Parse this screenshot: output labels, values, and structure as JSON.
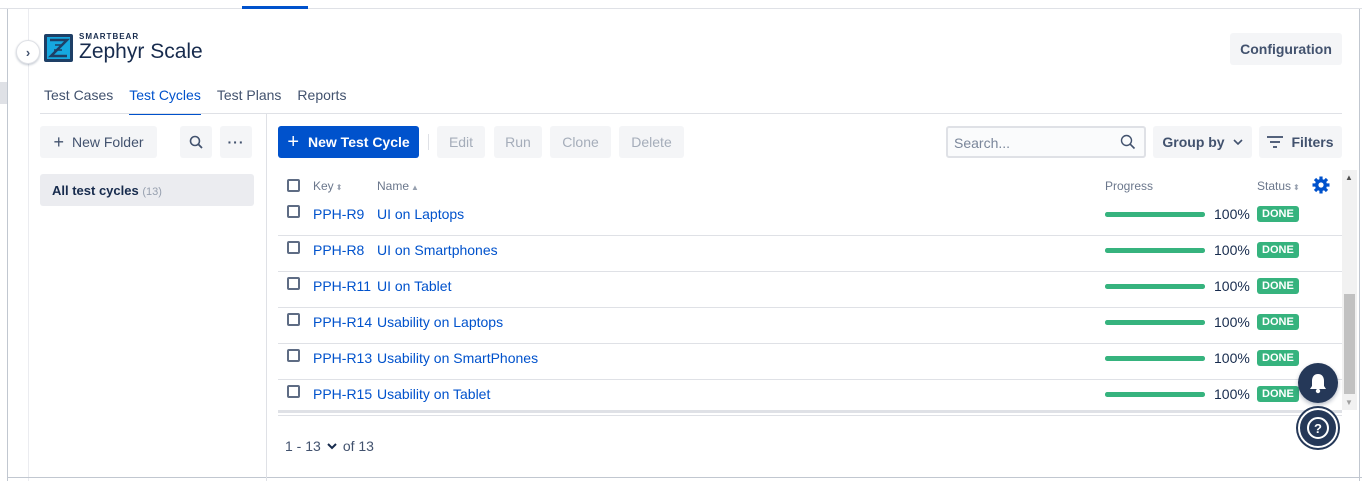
{
  "app": {
    "brand_small": "SMARTBEAR",
    "brand_name": "Zephyr Scale",
    "configuration_label": "Configuration"
  },
  "tabs": [
    {
      "label": "Test Cases",
      "active": false
    },
    {
      "label": "Test Cycles",
      "active": true
    },
    {
      "label": "Test Plans",
      "active": false
    },
    {
      "label": "Reports",
      "active": false
    }
  ],
  "sidebar": {
    "new_folder_label": "New Folder",
    "more_label": "···",
    "all_cycles_label": "All test cycles",
    "all_cycles_count": "(13)"
  },
  "toolbar": {
    "new_cycle_label": "New Test Cycle",
    "edit_label": "Edit",
    "run_label": "Run",
    "clone_label": "Clone",
    "delete_label": "Delete",
    "search_placeholder": "Search...",
    "group_by_label": "Group by",
    "filters_label": "Filters"
  },
  "table": {
    "headers": {
      "key": "Key",
      "name": "Name",
      "progress": "Progress",
      "status": "Status"
    },
    "rows": [
      {
        "key": "PPH-R9",
        "name": "UI on Laptops",
        "progress": 100,
        "progress_label": "100%",
        "status": "DONE"
      },
      {
        "key": "PPH-R8",
        "name": "UI on Smartphones",
        "progress": 100,
        "progress_label": "100%",
        "status": "DONE"
      },
      {
        "key": "PPH-R11",
        "name": "UI on Tablet",
        "progress": 100,
        "progress_label": "100%",
        "status": "DONE"
      },
      {
        "key": "PPH-R14",
        "name": "Usability on Laptops",
        "progress": 100,
        "progress_label": "100%",
        "status": "DONE"
      },
      {
        "key": "PPH-R13",
        "name": "Usability on SmartPhones",
        "progress": 100,
        "progress_label": "100%",
        "status": "DONE"
      },
      {
        "key": "PPH-R15",
        "name": "Usability on Tablet",
        "progress": 100,
        "progress_label": "100%",
        "status": "DONE"
      }
    ]
  },
  "pagination": {
    "range": "1 - 13",
    "of_label": "of 13"
  },
  "colors": {
    "primary": "#0052cc",
    "done": "#36b37e",
    "dark": "#253858"
  }
}
